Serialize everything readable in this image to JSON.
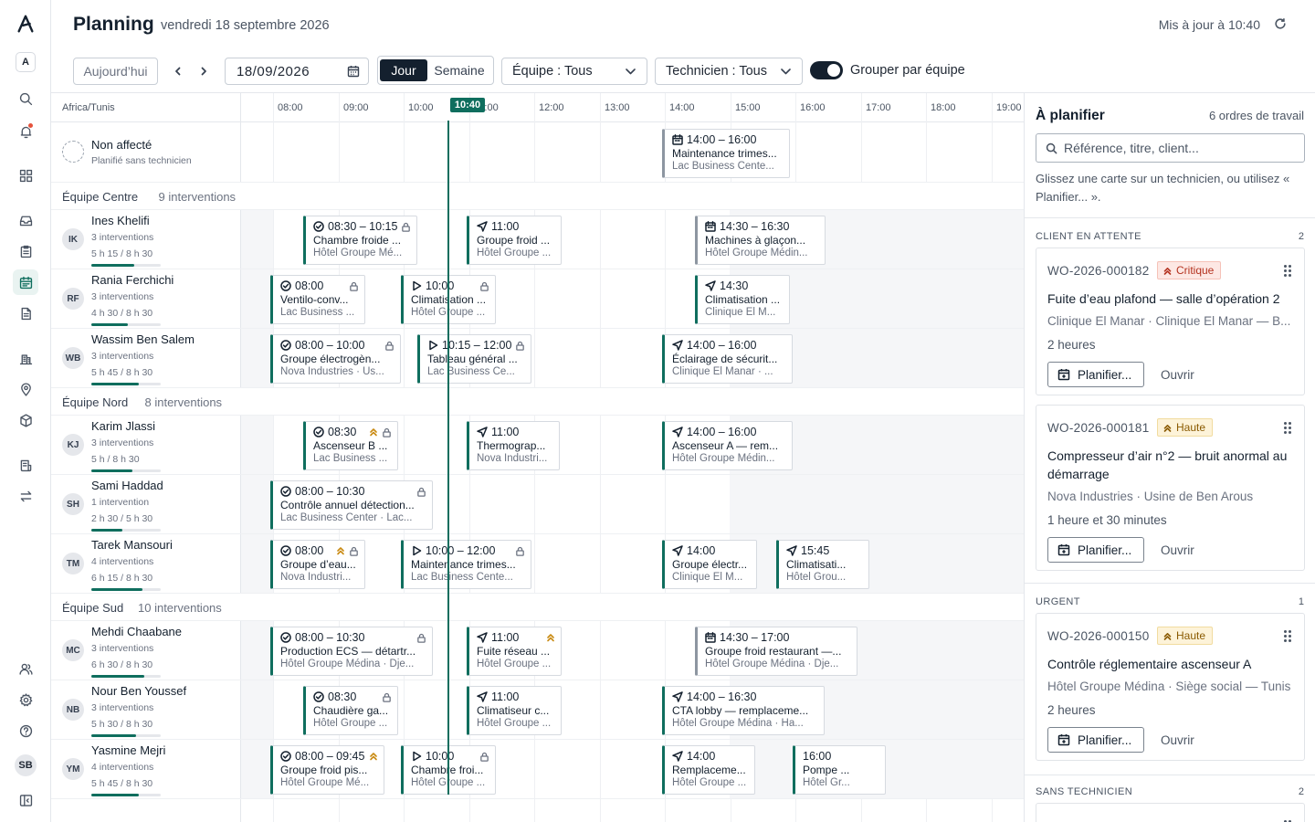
{
  "brand": {
    "workspace_initial": "A",
    "user_initials": "SB"
  },
  "header": {
    "title": "Planning",
    "date": "vendredi 18 septembre 2026",
    "sync": "Mis à jour à 10:40"
  },
  "toolbar": {
    "today": "Aujourd’hui",
    "date_value": "18/09/2026",
    "view_day": "Jour",
    "view_week": "Semaine",
    "team_filter": "Équipe : Tous",
    "tech_filter": "Technicien : Tous",
    "group_toggle_on": true,
    "group_label": "Grouper par équipe"
  },
  "board": {
    "timezone": "Africa/Tunis",
    "hours": [
      "08:00",
      "09:00",
      "10:00",
      "11:00",
      "12:00",
      "13:00",
      "14:00",
      "15:00",
      "16:00",
      "17:00",
      "18:00",
      "19:00"
    ],
    "now": "10:40",
    "unassigned": {
      "name": "Non affecté",
      "sub": "Planifié sans technicien"
    },
    "unassigned_cards": [
      {
        "time": "14:00 – 16:00",
        "title": "Maintenance trimes...",
        "site": "Lac Business Cente...",
        "icon": "calendar-icon"
      }
    ],
    "teams": [
      {
        "name": "Équipe Centre",
        "count": "9 interventions",
        "techs": [
          {
            "initials": "IK",
            "name": "Ines Khelifi",
            "count": "3 interventions",
            "load": "5 h 15 / 8 h 30",
            "ratio": 0.62,
            "cards": [
              {
                "time": "08:30 – 10:15",
                "title": "Chambre froide ...",
                "site": "Hôtel Groupe Mé...",
                "icon": "check-circle-icon",
                "lock": true
              },
              {
                "time": "11:00",
                "title": "Groupe froid ...",
                "site": "Hôtel Groupe ...",
                "icon": "navigation-icon"
              },
              {
                "time": "14:30 – 16:30",
                "title": "Machines à glaçon...",
                "site": "Hôtel Groupe Médin...",
                "icon": "calendar-icon"
              }
            ]
          },
          {
            "initials": "RF",
            "name": "Rania Ferchichi",
            "count": "3 interventions",
            "load": "4 h 30 / 8 h 30",
            "ratio": 0.53,
            "cards": [
              {
                "time": "08:00",
                "title": "Ventilo-conv...",
                "site": "Lac Business ...",
                "icon": "check-circle-icon",
                "lock": true
              },
              {
                "time": "10:00",
                "title": "Climatisation ...",
                "site": "Hôtel Groupe ...",
                "icon": "play-icon",
                "lock": true
              },
              {
                "time": "14:30",
                "title": "Climatisation ...",
                "site": "Clinique El M...",
                "icon": "navigation-icon"
              }
            ]
          },
          {
            "initials": "WB",
            "name": "Wassim Ben Salem",
            "count": "3 interventions",
            "load": "5 h 45 / 8 h 30",
            "ratio": 0.68,
            "cards": [
              {
                "time": "08:00 – 10:00",
                "title": "Groupe électrogèn...",
                "site": "Nova Industries · Us...",
                "icon": "check-circle-icon",
                "lock": true
              },
              {
                "time": "10:15 – 12:00",
                "title": "Tableau général ...",
                "site": "Lac Business Ce...",
                "icon": "play-icon",
                "lock": true
              },
              {
                "time": "14:00 – 16:00",
                "title": "Éclairage de sécurit...",
                "site": "Clinique El Manar · ...",
                "icon": "navigation-icon"
              }
            ]
          }
        ]
      },
      {
        "name": "Équipe Nord",
        "count": "8 interventions",
        "techs": [
          {
            "initials": "KJ",
            "name": "Karim Jlassi",
            "count": "3 interventions",
            "load": "5 h / 8 h 30",
            "ratio": 0.59,
            "cards": [
              {
                "time": "08:30",
                "title": "Ascenseur B ...",
                "site": "Lac Business ...",
                "icon": "check-circle-icon",
                "lock": true,
                "prio": true
              },
              {
                "time": "11:00",
                "title": "Thermograp...",
                "site": "Nova Industri...",
                "icon": "navigation-icon"
              },
              {
                "time": "14:00 – 16:00",
                "title": "Ascenseur A — rem...",
                "site": "Hôtel Groupe Médin...",
                "icon": "navigation-icon"
              }
            ]
          },
          {
            "initials": "SH",
            "name": "Sami Haddad",
            "count": "1 intervention",
            "load": "2 h 30 / 5 h 30",
            "ratio": 0.45,
            "cards": [
              {
                "time": "08:00 – 10:30",
                "title": "Contrôle annuel détection...",
                "site": "Lac Business Center · Lac...",
                "icon": "check-circle-icon",
                "lock": true
              }
            ]
          },
          {
            "initials": "TM",
            "name": "Tarek Mansouri",
            "count": "4 interventions",
            "load": "6 h 15 / 8 h 30",
            "ratio": 0.74,
            "cards": [
              {
                "time": "08:00",
                "title": "Groupe d’eau...",
                "site": "Nova Industri...",
                "icon": "check-circle-icon",
                "lock": true,
                "prio": true
              },
              {
                "time": "10:00 – 12:00",
                "title": "Maintenance trimes...",
                "site": "Lac Business Cente...",
                "icon": "play-icon",
                "lock": true
              },
              {
                "time": "14:00",
                "title": "Groupe électr...",
                "site": "Clinique El M...",
                "icon": "navigation-icon"
              },
              {
                "time": "15:45",
                "title": "Climatisati...",
                "site": "Hôtel Grou...",
                "icon": "navigation-icon"
              }
            ]
          }
        ]
      },
      {
        "name": "Équipe Sud",
        "count": "10 interventions",
        "techs": [
          {
            "initials": "MC",
            "name": "Mehdi Chaabane",
            "count": "3 interventions",
            "load": "6 h 30 / 8 h 30",
            "ratio": 0.76,
            "cards": [
              {
                "time": "08:00 – 10:30",
                "title": "Production ECS — détartr...",
                "site": "Hôtel Groupe Médina · Dje...",
                "icon": "check-circle-icon",
                "lock": true
              },
              {
                "time": "11:00",
                "title": "Fuite réseau ...",
                "site": "Hôtel Groupe ...",
                "icon": "navigation-icon",
                "prio": true
              },
              {
                "time": "14:30 – 17:00",
                "title": "Groupe froid restaurant —...",
                "site": "Hôtel Groupe Médina · Dje...",
                "icon": "calendar-icon"
              }
            ]
          },
          {
            "initials": "NB",
            "name": "Nour Ben Youssef",
            "count": "3 interventions",
            "load": "5 h 30 / 8 h 30",
            "ratio": 0.65,
            "cards": [
              {
                "time": "08:30",
                "title": "Chaudière ga...",
                "site": "Hôtel Groupe ...",
                "icon": "check-circle-icon",
                "lock": true
              },
              {
                "time": "11:00",
                "title": "Climatiseur c...",
                "site": "Hôtel Groupe ...",
                "icon": "navigation-icon"
              },
              {
                "time": "14:00 – 16:30",
                "title": "CTA lobby — remplaceme...",
                "site": "Hôtel Groupe Médina · Ha...",
                "icon": "navigation-icon"
              }
            ]
          },
          {
            "initials": "YM",
            "name": "Yasmine Mejri",
            "count": "4 interventions",
            "load": "5 h 45 / 8 h 30",
            "ratio": 0.68,
            "cards": [
              {
                "time": "08:00 – 09:45",
                "title": "Groupe froid pis...",
                "site": "Hôtel Groupe Mé...",
                "icon": "check-circle-icon",
                "prio": true
              },
              {
                "time": "10:00",
                "title": "Chambre froi...",
                "site": "Hôtel Groupe ...",
                "icon": "play-icon",
                "lock": true
              },
              {
                "time": "14:00",
                "title": "Remplaceme...",
                "site": "Hôtel Groupe ...",
                "icon": "navigation-icon"
              },
              {
                "time": "16:00",
                "title": "Pompe ...",
                "site": "Hôtel Gr...",
                "icon": "none"
              }
            ]
          }
        ]
      }
    ]
  },
  "panel": {
    "title": "À planifier",
    "count": "6 ordres de travail",
    "search_placeholder": "Référence, titre, client...",
    "hint": "Glissez une carte sur un technicien, ou utilisez « Planifier... ».",
    "plan_label": "Planifier...",
    "open_label": "Ouvrir",
    "sections": [
      {
        "label": "CLIENT EN ATTENTE",
        "count": "2"
      },
      {
        "label": "URGENT",
        "count": "1"
      },
      {
        "label": "SANS TECHNICIEN",
        "count": "2"
      }
    ],
    "orders": [
      {
        "ref": "WO-2026-000182",
        "priority": "Critique",
        "title": "Fuite d’eau plafond — salle d’opération 2",
        "site": "Clinique El Manar · Clinique El Manar — B...",
        "duration": "2 heures"
      },
      {
        "ref": "WO-2026-000181",
        "priority": "Haute",
        "title": "Compresseur d’air n°2 — bruit anormal au démarrage",
        "site": "Nova Industries · Usine de Ben Arous",
        "duration": "1 heure et 30 minutes"
      },
      {
        "ref": "WO-2026-000150",
        "priority": "Haute",
        "title": "Contrôle réglementaire ascenseur A",
        "site": "Hôtel Groupe Médina · Siège social — Tunis",
        "duration": "2 heures"
      }
    ]
  },
  "colors": {
    "accent": "#0f6e5e",
    "critical": "#b4321f",
    "high": "#c98a12",
    "ink": "#14202e"
  }
}
